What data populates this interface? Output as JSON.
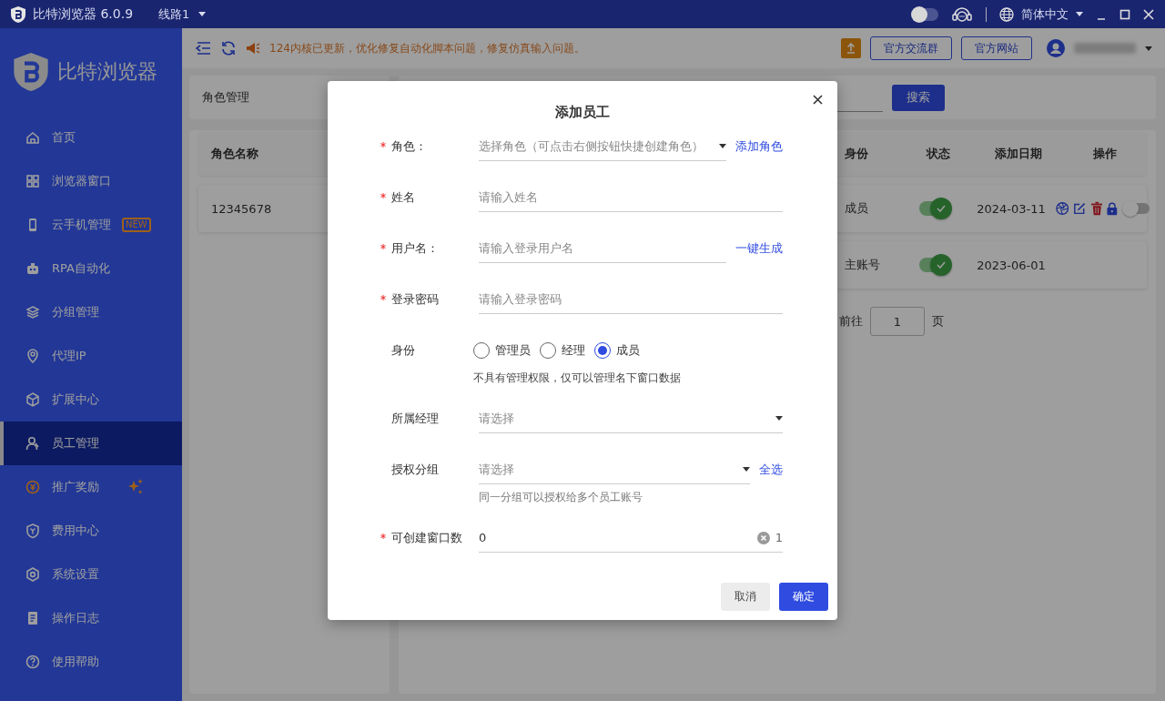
{
  "titlebar": {
    "app_title": "比特浏览器 6.0.9",
    "route": "线路1",
    "dark_mode": false,
    "language": "简体中文"
  },
  "sidebar": {
    "logo_text": "比特浏览器",
    "items": [
      {
        "label": "首页",
        "selected": false,
        "featured": false
      },
      {
        "label": "浏览器窗口",
        "selected": false,
        "featured": false
      },
      {
        "label": "云手机管理",
        "selected": false,
        "featured": false,
        "badge": "NEW"
      },
      {
        "label": "RPA自动化",
        "selected": false,
        "featured": false
      },
      {
        "label": "分组管理",
        "selected": false,
        "featured": false
      },
      {
        "label": "代理IP",
        "selected": false,
        "featured": false
      },
      {
        "label": "扩展中心",
        "selected": false,
        "featured": false
      },
      {
        "label": "员工管理",
        "selected": true,
        "featured": false
      },
      {
        "label": "推广奖励",
        "selected": false,
        "featured": true
      },
      {
        "label": "费用中心",
        "selected": false,
        "featured": false
      },
      {
        "label": "系统设置",
        "selected": false,
        "featured": false
      },
      {
        "label": "操作日志",
        "selected": false,
        "featured": false
      },
      {
        "label": "使用帮助",
        "selected": false,
        "featured": false
      }
    ]
  },
  "toolbar": {
    "notice": "124内核已更新，优化修复自动化脚本问题，修复仿真输入问题。",
    "buttons": [
      "官方交流群",
      "官方网站"
    ]
  },
  "roles_panel": {
    "title": "角色管理",
    "columns": [
      "角色名称"
    ],
    "rows": [
      [
        "12345678"
      ]
    ]
  },
  "staff_panel": {
    "search_button": "搜索",
    "columns": [
      "身份",
      "状态",
      "添加日期",
      "操作"
    ],
    "rows": [
      {
        "kind": "member",
        "identity": "成员",
        "enabled": true,
        "date": "2024-03-11",
        "login_on": false
      },
      {
        "kind": "owner",
        "identity": "主账号",
        "enabled": true,
        "date": "2023-06-01"
      }
    ],
    "goto_label": "前往",
    "page": "1",
    "page_suffix": "页"
  },
  "dialog": {
    "title": "添加员工",
    "fields": [
      {
        "kind": "select",
        "label": "角色：",
        "required": true,
        "placeholder": "选择角色（可点击右侧按钮快捷创建角色）",
        "link": "添加角色"
      },
      {
        "kind": "input",
        "label": "姓名",
        "required": true,
        "placeholder": "请输入姓名"
      },
      {
        "kind": "input",
        "label": "用户名：",
        "required": true,
        "placeholder": "请输入登录用户名",
        "link": "一键生成"
      },
      {
        "kind": "input",
        "label": "登录密码",
        "required": true,
        "placeholder": "请输入登录密码"
      },
      {
        "kind": "radio",
        "label": "身份",
        "required": false,
        "options": [
          {
            "label": "管理员",
            "selected": false
          },
          {
            "label": "经理",
            "selected": false
          },
          {
            "label": "成员",
            "selected": true
          }
        ],
        "hint": "不具有管理权限，仅可以管理名下窗口数据"
      },
      {
        "kind": "select",
        "label": "所属经理",
        "required": false,
        "placeholder": "请选择"
      },
      {
        "kind": "select",
        "label": "授权分组",
        "required": false,
        "placeholder": "请选择",
        "link": "全选",
        "hint": "同一分组可以授权给多个员工账号"
      },
      {
        "kind": "number",
        "label": "可创建窗口数",
        "required": true,
        "value": "0",
        "counter": "1"
      }
    ],
    "buttons": [
      {
        "label": "取消",
        "primary": false
      },
      {
        "label": "确定",
        "primary": true
      }
    ]
  }
}
